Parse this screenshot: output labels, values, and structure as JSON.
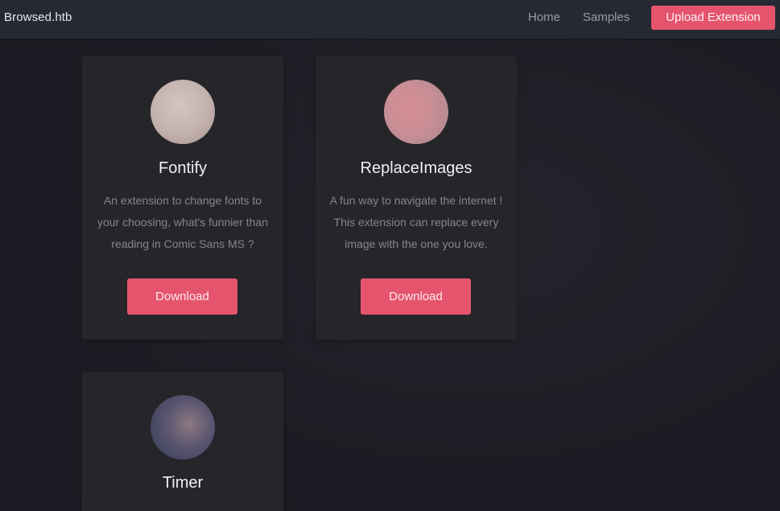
{
  "navbar": {
    "brand": "Browsed.htb",
    "links": [
      "Home",
      "Samples"
    ],
    "upload_label": "Upload Extension"
  },
  "extensions": [
    {
      "title": "Fontify",
      "description": "An extension to change fonts to your choosing, what's funnier than reading in Comic Sans MS ?",
      "download_label": "Download",
      "image_icon": "extension-image-icon"
    },
    {
      "title": "ReplaceImages",
      "description": "A fun way to navigate the internet ! This extension can replace every image with the one you love.",
      "download_label": "Download",
      "image_icon": "extension-image-icon"
    },
    {
      "title": "Timer",
      "description": "",
      "download_label": "",
      "image_icon": "extension-image-icon"
    }
  ],
  "colors": {
    "accent": "#e5546d",
    "navbar_bg": "#262833",
    "page_bg": "#1e1f26",
    "card_bg": "#25252a"
  }
}
